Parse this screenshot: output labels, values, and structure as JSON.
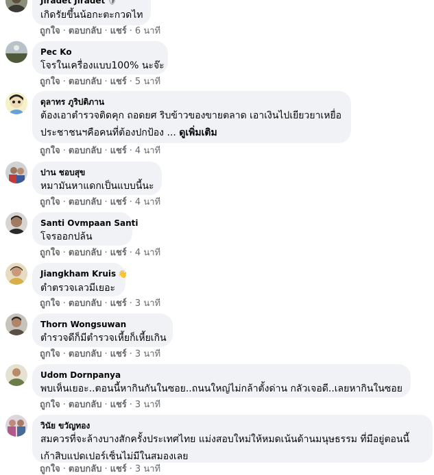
{
  "action_labels": {
    "like": "ถูกใจ",
    "reply": "ตอบกลับ",
    "share": "แชร์",
    "separator": "·"
  },
  "comments": [
    {
      "author": "Jiradet Jiradet",
      "badge": "🛡",
      "lines": [
        "เกิดรัยขึ้นน้อกะตะกวดไท"
      ],
      "more": "",
      "time": "6 นาที"
    },
    {
      "author": "Pec Ko",
      "badge": "",
      "lines": [
        "โจรในเครื่องแบบ100% นะจ๊ะ"
      ],
      "more": "",
      "time": "5 นาที"
    },
    {
      "author": "ดุลาทร ภูริปติภาน",
      "badge": "",
      "lines": [
        "ต้องเอาตำรวจติดคุก ถอดยศ ริบข้าวของขายตลาด เอาเงินไปเยียวยาเหยื่อ",
        "ประชาชนฯคือคนที่ต้องปกป้อง ..."
      ],
      "more": "ดูเพิ่มเติม",
      "time": "4 นาที"
    },
    {
      "author": "ปาน ชอบสุข",
      "badge": "",
      "lines": [
        "หมามันหาแดกเป็นแบบนี้นะ"
      ],
      "more": "",
      "time": "4 นาที"
    },
    {
      "author": "Santi Ovmpaan Santi",
      "badge": "",
      "lines": [
        "โจรออกปล้น"
      ],
      "more": "",
      "time": "4 นาที"
    },
    {
      "author": "Jiangkham Kruis",
      "badge": "👋",
      "lines": [
        "ตำตรวจเลวมีเยอะ"
      ],
      "more": "",
      "time": "3 นาที"
    },
    {
      "author": "Thorn Wongsuwan",
      "badge": "",
      "lines": [
        "ตำรวจดีก็มีตำรวจเหี้ยก็เหี้ยเกิน"
      ],
      "more": "",
      "time": "3 นาที"
    },
    {
      "author": "Udom Dornpanya",
      "badge": "",
      "lines": [
        "พบเห็นเยอะ..ตอนนี้หากินกันในซอย..ถนนใหญ่ไม่กล้าตั้งด่าน กลัวเจอดี..เลยหากินในซอย"
      ],
      "more": "",
      "time": "3 นาที"
    },
    {
      "author": "วินัย ขวัญทอง",
      "badge": "",
      "lines": [
        "สมควรที่จะล้างบางสักครั้งประเทศไทย แม่งสอบใหม่ให้หมดเน้นด้านมนุษธรรม ที่มีอยู่ตอนนี้",
        "เก้าสิบแปดเปอร์เซ็นไม่มีในสมองเลย"
      ],
      "more": "",
      "time": "3 นาที"
    }
  ]
}
